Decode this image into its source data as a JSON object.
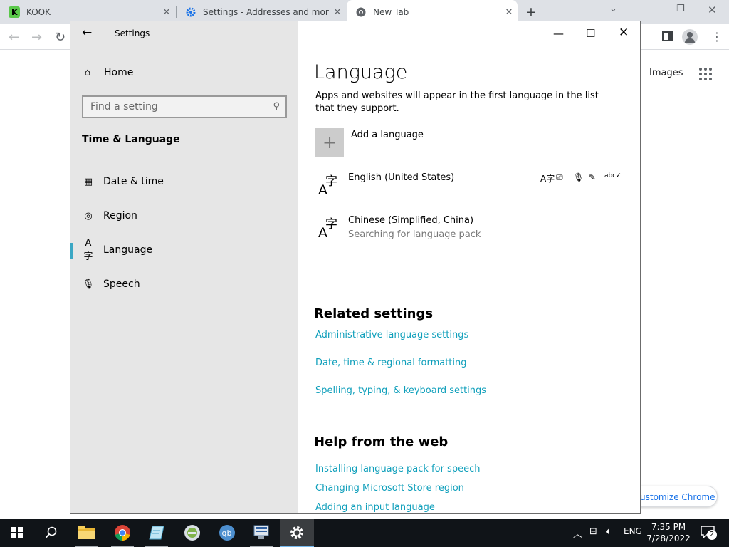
{
  "chrome": {
    "tabs": [
      {
        "title": "KOOK",
        "icon": "kook-app-icon"
      },
      {
        "title": "Settings - Addresses and more",
        "icon": "gear-icon"
      },
      {
        "title": "New Tab",
        "icon": "chrome-icon"
      }
    ],
    "new_tab_symbol": "+",
    "images_link": "Images",
    "customize_button": "ustomize Chrome"
  },
  "settings": {
    "window_title": "Settings",
    "home_label": "Home",
    "search_placeholder": "Find a setting",
    "section_heading": "Time & Language",
    "nav": [
      {
        "label": "Date & time",
        "icon": "calendar-clock-icon"
      },
      {
        "label": "Region",
        "icon": "globe-icon"
      },
      {
        "label": "Language",
        "icon": "language-icon",
        "selected": true
      },
      {
        "label": "Speech",
        "icon": "microphone-icon"
      }
    ],
    "page_heading": "Language",
    "description": "Apps and websites will appear in the first language in the list that they support.",
    "add_language": "Add a language",
    "languages": [
      {
        "name": "English (United States)",
        "status": ""
      },
      {
        "name": "Chinese (Simplified, China)",
        "status": "Searching for language pack"
      }
    ],
    "feature_icons": [
      "display-language-icon",
      "text-to-speech-icon",
      "speech-recognition-icon",
      "handwriting-icon",
      "spellcheck-icon"
    ],
    "related_heading": "Related settings",
    "related_links": [
      "Administrative language settings",
      "Date, time & regional formatting",
      "Spelling, typing, & keyboard settings"
    ],
    "help_heading": "Help from the web",
    "help_links": [
      "Installing language pack for speech",
      "Changing Microsoft Store region",
      "Adding an input language"
    ]
  },
  "taskbar": {
    "apps": [
      "start-icon",
      "search-icon",
      "file-explorer-icon",
      "chrome-icon",
      "notepad-icon",
      "network-app-icon",
      "qbittorrent-icon",
      "remote-desktop-icon",
      "settings-icon"
    ],
    "language": "ENG",
    "time": "7:35 PM",
    "date": "7/28/2022",
    "notification_count": "2"
  }
}
